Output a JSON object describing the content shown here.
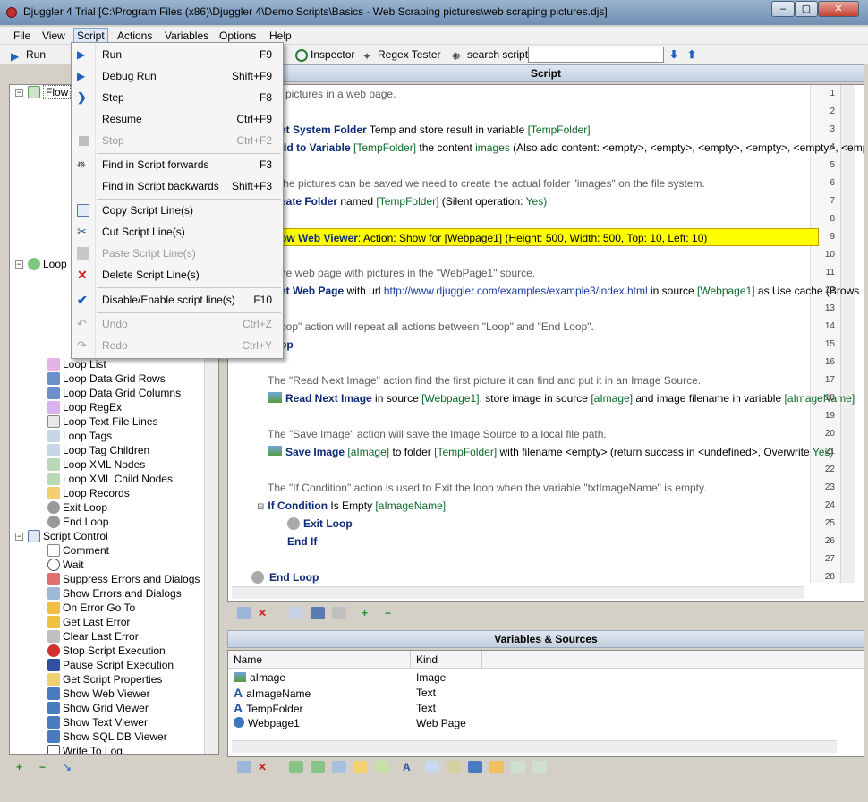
{
  "window": {
    "title": "Djuggler 4 Trial [C:\\Program Files (x86)\\Djuggler 4\\Demo Scripts\\Basics - Web Scraping pictures\\web scraping pictures.djs]",
    "min": "–",
    "max": "▢",
    "close": "✕",
    "watermark": "SOFTPEDIA"
  },
  "menubar": [
    "File",
    "View",
    "Script",
    "Actions",
    "Variables",
    "Options",
    "Help"
  ],
  "toolbar": {
    "run": "Run",
    "inspector": "Inspector",
    "regex": "Regex Tester",
    "search_label": "search script",
    "search_value": ""
  },
  "popup": {
    "items": [
      {
        "label": "Run",
        "key": "F9",
        "disabled": false
      },
      {
        "label": "Debug Run",
        "key": "Shift+F9",
        "disabled": false
      },
      {
        "label": "Step",
        "key": "F8",
        "disabled": false
      },
      {
        "label": "Resume",
        "key": "Ctrl+F9",
        "disabled": false
      },
      {
        "label": "Stop",
        "key": "Ctrl+F2",
        "disabled": true
      },
      {
        "label": "Find in Script forwards",
        "key": "F3",
        "disabled": false
      },
      {
        "label": "Find in Script backwards",
        "key": "Shift+F3",
        "disabled": false
      },
      {
        "label": "Copy Script Line(s)",
        "key": "",
        "disabled": false
      },
      {
        "label": "Cut Script Line(s)",
        "key": "",
        "disabled": false
      },
      {
        "label": "Paste Script Line(s)",
        "key": "",
        "disabled": true
      },
      {
        "label": "Delete Script Line(s)",
        "key": "",
        "disabled": false
      },
      {
        "label": "Disable/Enable script line(s)",
        "key": "F10",
        "disabled": false
      },
      {
        "label": "Undo",
        "key": "Ctrl+Z",
        "disabled": true
      },
      {
        "label": "Redo",
        "key": "Ctrl+Y",
        "disabled": true
      }
    ]
  },
  "tree": {
    "group1": "Flow",
    "group2": "Loop",
    "group3": "Script Control",
    "loop_items": [
      "Loop List",
      "Loop Data Grid Rows",
      "Loop Data Grid Columns",
      "Loop RegEx",
      "Loop Text File Lines",
      "Loop Tags",
      "Loop Tag Children",
      "Loop XML Nodes",
      "Loop XML Child Nodes",
      "Loop Records",
      "Exit Loop",
      "End Loop"
    ],
    "control_items": [
      "Comment",
      "Wait",
      "Suppress Errors and Dialogs",
      "Show Errors and Dialogs",
      "On Error Go To",
      "Get Last Error",
      "Clear Last Error",
      "Stop Script Execution",
      "Pause Script Execution",
      "Get Script Properties",
      "Show Web Viewer",
      "Show Grid Viewer",
      "Show Text Viewer",
      "Show SQL DB Viewer",
      "Write To Log"
    ]
  },
  "script": {
    "header": "Script",
    "lines": [
      {
        "n": "1",
        "html_text": "l pictures in a web page.",
        "type": "cmt"
      },
      {
        "n": "2",
        "type": "blank"
      },
      {
        "n": "3",
        "kw": "et System Folder",
        "rest": "Temp and store result in variable",
        "var": "[TempFolder]"
      },
      {
        "n": "4",
        "kw": "dd to Variable",
        "var": "[TempFolder]",
        "rest": "the content",
        "var2": "images",
        "tail": "(Also add content: <empty>, <empty>, <empty>, <empty>, <empty>, <empty>, <em"
      },
      {
        "n": "5",
        "type": "blank"
      },
      {
        "n": "6",
        "html_text": "the pictures can be saved we need to create the actual folder \"images\" on the file system.",
        "type": "cmt"
      },
      {
        "n": "7",
        "kw": "eate Folder",
        "rest": "named",
        "var": "[TempFolder]",
        "tail": "(Silent operation:",
        "var2": "Yes)"
      },
      {
        "n": "8",
        "type": "blank"
      },
      {
        "n": "9",
        "kw": "ow Web Viewer",
        "rest": ": Action:  Show for  [Webpage1] (Height:  500, Width:  500, Top:  10, Left:  10)",
        "type": "hl"
      },
      {
        "n": "10",
        "type": "blank"
      },
      {
        "n": "11",
        "html_text": "he web page with pictures in the \"WebPage1\" source.",
        "type": "cmt"
      },
      {
        "n": "12",
        "kw": "et Web Page",
        "rest": "with url",
        "url": "http://www.djuggler.com/examples/example3/index.html",
        "tail": "in source",
        "var": "[Webpage1]",
        "tail2": "as  Use cache (Brows"
      },
      {
        "n": "13",
        "type": "blank"
      },
      {
        "n": "14",
        "html_text": "oop\" action will repeat all actions between \"Loop\" and \"End Loop\".",
        "type": "cmt"
      },
      {
        "n": "15",
        "kw": "op"
      },
      {
        "n": "16",
        "type": "blank"
      },
      {
        "n": "17",
        "html_text": "The \"Read Next Image\" action find the first picture it can find and put it in an Image Source.",
        "type": "cmt"
      },
      {
        "n": "18",
        "kw": "Read Next Image",
        "rest": "in source",
        "var": "[Webpage1]",
        "tail": ", store image in source",
        "var2": "[aImage]",
        "tail2": "and image filename in variable",
        "var3": "[aImageName]"
      },
      {
        "n": "19",
        "type": "blank"
      },
      {
        "n": "20",
        "html_text": "The \"Save Image\" action will save the Image Source to a local file path.",
        "type": "cmt"
      },
      {
        "n": "21",
        "kw": "Save Image",
        "var": "[aImage]",
        "rest": "to folder",
        "var2": "[TempFolder]",
        "tail": "with filename <empty> (return success in <undefined>, Overwrite",
        "var3": "Yes)"
      },
      {
        "n": "22",
        "type": "blank"
      },
      {
        "n": "23",
        "html_text": "The \"If Condition\" action is used to Exit the loop when the variable \"txtImageName\" is empty.",
        "type": "cmt"
      },
      {
        "n": "24",
        "kw": "If Condition",
        "rest": "Is Empty",
        "var": "[aImageName]"
      },
      {
        "n": "25",
        "kw": "Exit Loop"
      },
      {
        "n": "26",
        "kw": "End If"
      },
      {
        "n": "27",
        "type": "blank"
      },
      {
        "n": "28",
        "kw": "End Loop"
      }
    ]
  },
  "variables": {
    "header": "Variables & Sources",
    "col_name": "Name",
    "col_kind": "Kind",
    "rows": [
      {
        "name": "aImage",
        "kind": "Image"
      },
      {
        "name": "aImageName",
        "kind": "Text"
      },
      {
        "name": "TempFolder",
        "kind": "Text"
      },
      {
        "name": "Webpage1",
        "kind": "Web Page"
      }
    ]
  },
  "colors": {
    "accent": "#0d2a78",
    "var": "#0a6a2a",
    "highlight": "#ffff00"
  }
}
